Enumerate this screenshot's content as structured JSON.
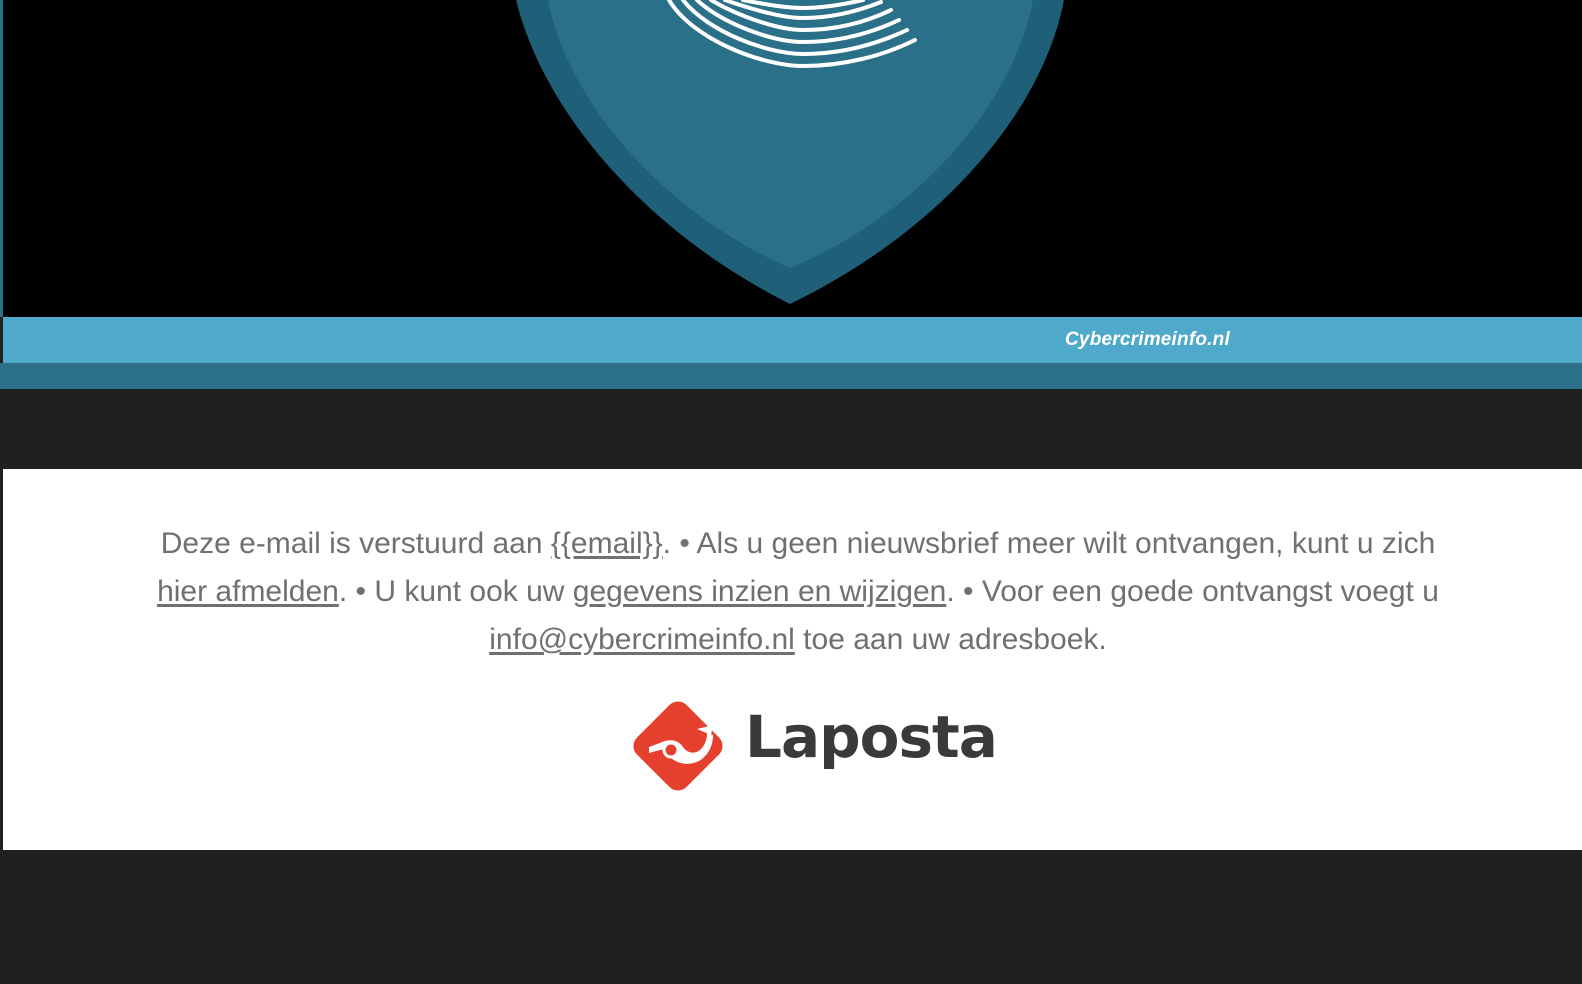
{
  "hero": {
    "tagline": "Cybercrimeinfo.nl",
    "colors": {
      "background": "#000000",
      "shield_outer": "#1f5f77",
      "shield_inner": "#2a7088",
      "lines": "#ffffff"
    }
  },
  "footer": {
    "text_part1": "Deze e-mail is verstuurd aan ",
    "email_placeholder": "{{email}}",
    "text_part2": ". • Als u geen nieuwsbrief meer wilt ontvangen, kunt u zich ",
    "unsubscribe_link": "hier afmelden",
    "text_part3": ". • U kunt ook uw ",
    "profile_link": "gegevens inzien en wijzigen",
    "text_part4": ". • Voor een goede ontvangst voegt u ",
    "address_link": "info@cybercrimeinfo.nl",
    "text_part5": " toe aan uw adresboek."
  },
  "branding": {
    "name": "Laposta",
    "icon": "post-horn-icon",
    "color": "#e4402d"
  },
  "colors": {
    "page_background": "#202020",
    "band_light": "#4ea9cb",
    "band_dark": "#2b6f88",
    "footer_text": "#707070"
  }
}
